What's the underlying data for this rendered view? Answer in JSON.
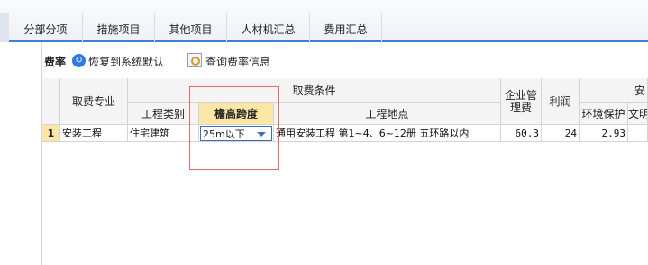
{
  "tabs": [
    {
      "label": "分部分项"
    },
    {
      "label": "措施项目"
    },
    {
      "label": "其他项目"
    },
    {
      "label": "人材机汇总"
    },
    {
      "label": "费用汇总"
    }
  ],
  "toolbar": {
    "title": "费率",
    "restore_label": "恢复到系统默认",
    "query_label": "查询费率信息"
  },
  "table": {
    "headers": {
      "fee_specialty": "取费专业",
      "fee_conditions": "取费条件",
      "project_type": "工程类别",
      "eave_height_span": "檐高跨度",
      "project_location": "工程地点",
      "mgmt_fee": "企业管理费",
      "profit": "利润",
      "safety_group": "安",
      "env_protection": "环境保护",
      "civilized": "文明"
    },
    "rows": [
      {
        "index": "1",
        "fee_specialty": "安装工程",
        "project_type": "住宅建筑",
        "eave_height_span": "25m以下",
        "project_location": "通用安装工程 第1~4、6~12册 五环路以内",
        "mgmt_fee": "60.3",
        "profit": "24",
        "env_protection": "2.93",
        "civilized": ""
      }
    ]
  },
  "colors": {
    "accent": "#3f7fd0",
    "highlight_header": "#fbe6a6",
    "annotation_box": "#e36b6b"
  }
}
